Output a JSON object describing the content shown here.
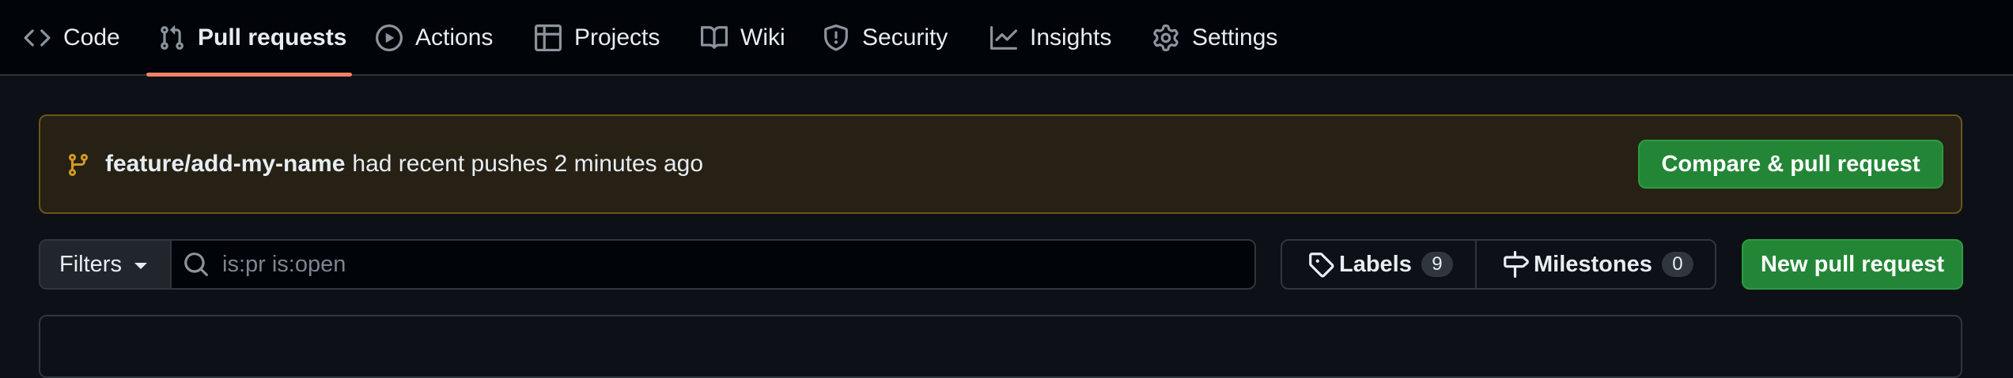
{
  "nav": {
    "tabs": [
      {
        "label": "Code",
        "icon": "code-icon"
      },
      {
        "label": "Pull requests",
        "icon": "git-pull-request-icon"
      },
      {
        "label": "Actions",
        "icon": "play-icon"
      },
      {
        "label": "Projects",
        "icon": "table-icon"
      },
      {
        "label": "Wiki",
        "icon": "book-icon"
      },
      {
        "label": "Security",
        "icon": "shield-icon"
      },
      {
        "label": "Insights",
        "icon": "graph-icon"
      },
      {
        "label": "Settings",
        "icon": "gear-icon"
      }
    ],
    "selected": "Pull requests",
    "accent": "#f78166"
  },
  "banner": {
    "branch": "feature/add-my-name",
    "message": "had recent pushes 2 minutes ago",
    "button_label": "Compare & pull request",
    "icon": "git-branch-icon",
    "color": "#d29922"
  },
  "filter": {
    "filters_label": "Filters",
    "search_value": "",
    "search_placeholder": "is:pr is:open",
    "labels_label": "Labels",
    "labels_count": "9",
    "milestones_label": "Milestones",
    "milestones_count": "0",
    "new_pr_label": "New pull request"
  },
  "colors": {
    "background": "#0d1117",
    "primary_button": "#238636"
  }
}
